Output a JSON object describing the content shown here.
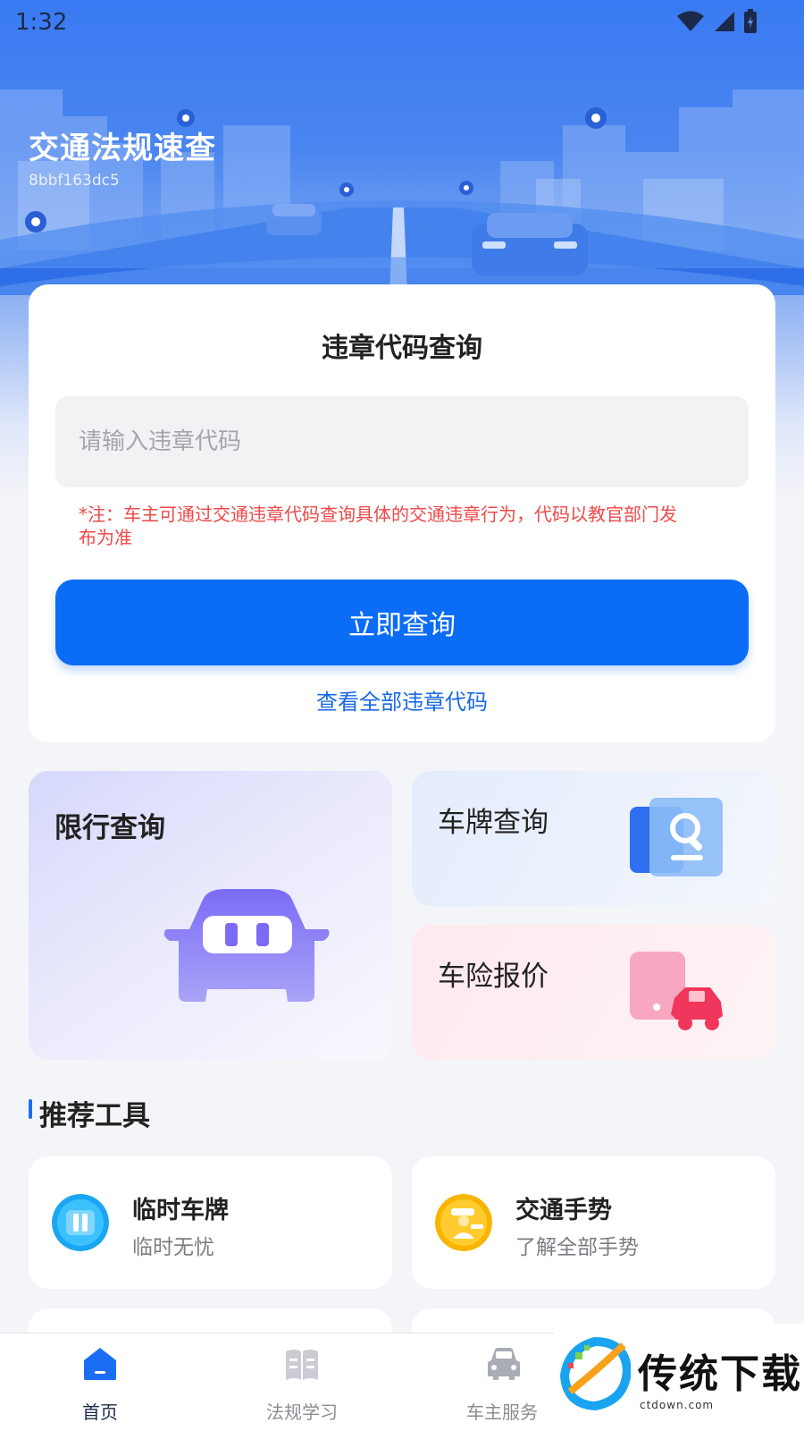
{
  "status": {
    "time": "1:32"
  },
  "header": {
    "title": "交通法规速查",
    "subtitle": "8bbf163dc5"
  },
  "query": {
    "title": "违章代码查询",
    "placeholder": "请输入违章代码",
    "note": "*注：车主可通过交通违章代码查询具体的交通违章行为，代码以教官部门发布为准",
    "button": "立即查询",
    "link": "查看全部违章代码"
  },
  "features": {
    "restrict": "限行查询",
    "plate": "车牌查询",
    "insurance": "车险报价"
  },
  "recommend": {
    "title": "推荐工具",
    "tools": [
      {
        "name": "临时车牌",
        "desc": "临时无忧",
        "icon": "temporary-plate-icon",
        "color": "#1aa6f2"
      },
      {
        "name": "交通手势",
        "desc": "了解全部手势",
        "icon": "traffic-police-icon",
        "color": "#f7b500"
      }
    ]
  },
  "nav": [
    {
      "label": "首页",
      "icon": "home-icon",
      "active": true
    },
    {
      "label": "法规学习",
      "icon": "book-icon",
      "active": false
    },
    {
      "label": "车主服务",
      "icon": "car-icon",
      "active": false
    }
  ],
  "watermark": {
    "text": "传统下载",
    "sub": "ctdown.com"
  },
  "colors": {
    "primary": "#0b6cf5",
    "note": "#f04848",
    "link": "#1869e6"
  }
}
